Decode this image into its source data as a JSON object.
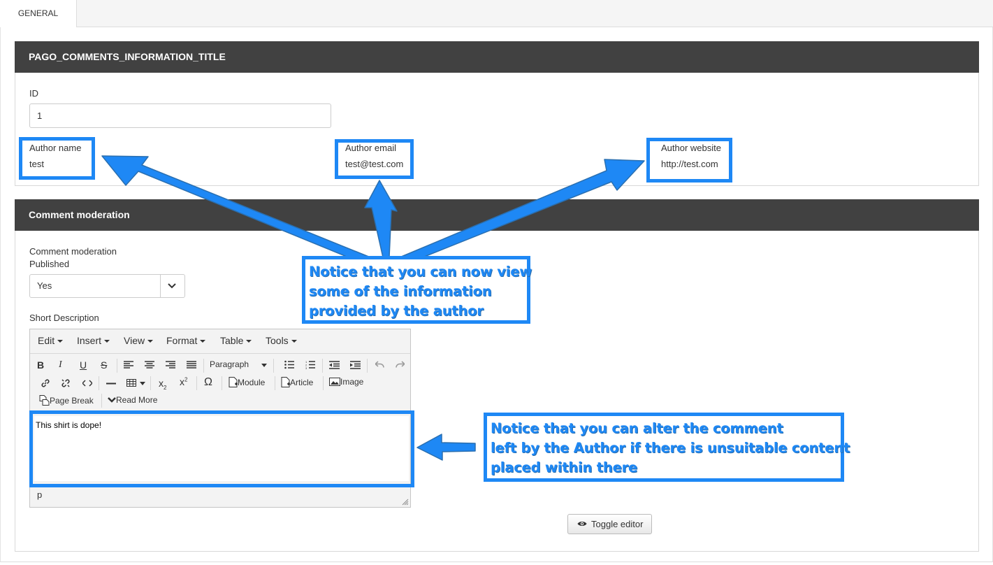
{
  "tabs": [
    {
      "label": "GENERAL"
    }
  ],
  "info_panel": {
    "title": "PAGO_COMMENTS_INFORMATION_TITLE",
    "id_label": "ID",
    "id_value": "1",
    "author_name_label": "Author name",
    "author_name_value": "test",
    "author_email_label": "Author email",
    "author_email_value": "test@test.com",
    "author_website_label": "Author website",
    "author_website_value": "http://test.com"
  },
  "moderation_panel": {
    "title": "Comment moderation",
    "moderation_label": "Comment moderation",
    "published_label": "Published",
    "published_value": "Yes",
    "short_desc_label": "Short Description"
  },
  "editor": {
    "menu": [
      "Edit",
      "Insert",
      "View",
      "Format",
      "Table",
      "Tools"
    ],
    "toolbar": {
      "bold": "B",
      "italic": "I",
      "underline": "U",
      "strike": "S",
      "paragraph": "Paragraph",
      "module": "Module",
      "article": "Article",
      "image": "Image",
      "page_break": "Page Break",
      "read_more": "Read More",
      "omega": "Ω"
    },
    "content": "This shirt is dope!",
    "path": "p"
  },
  "toggle_editor_label": "Toggle editor",
  "annotations": {
    "note1": [
      "Notice that you can now view",
      "some of the information",
      "provided by the author"
    ],
    "note2": [
      "Notice that you can alter the comment",
      "left by the Author if there is unsuitable content",
      "placed within there"
    ]
  },
  "colors": {
    "annotation": "#1e88f5",
    "panel_header": "#414141"
  }
}
